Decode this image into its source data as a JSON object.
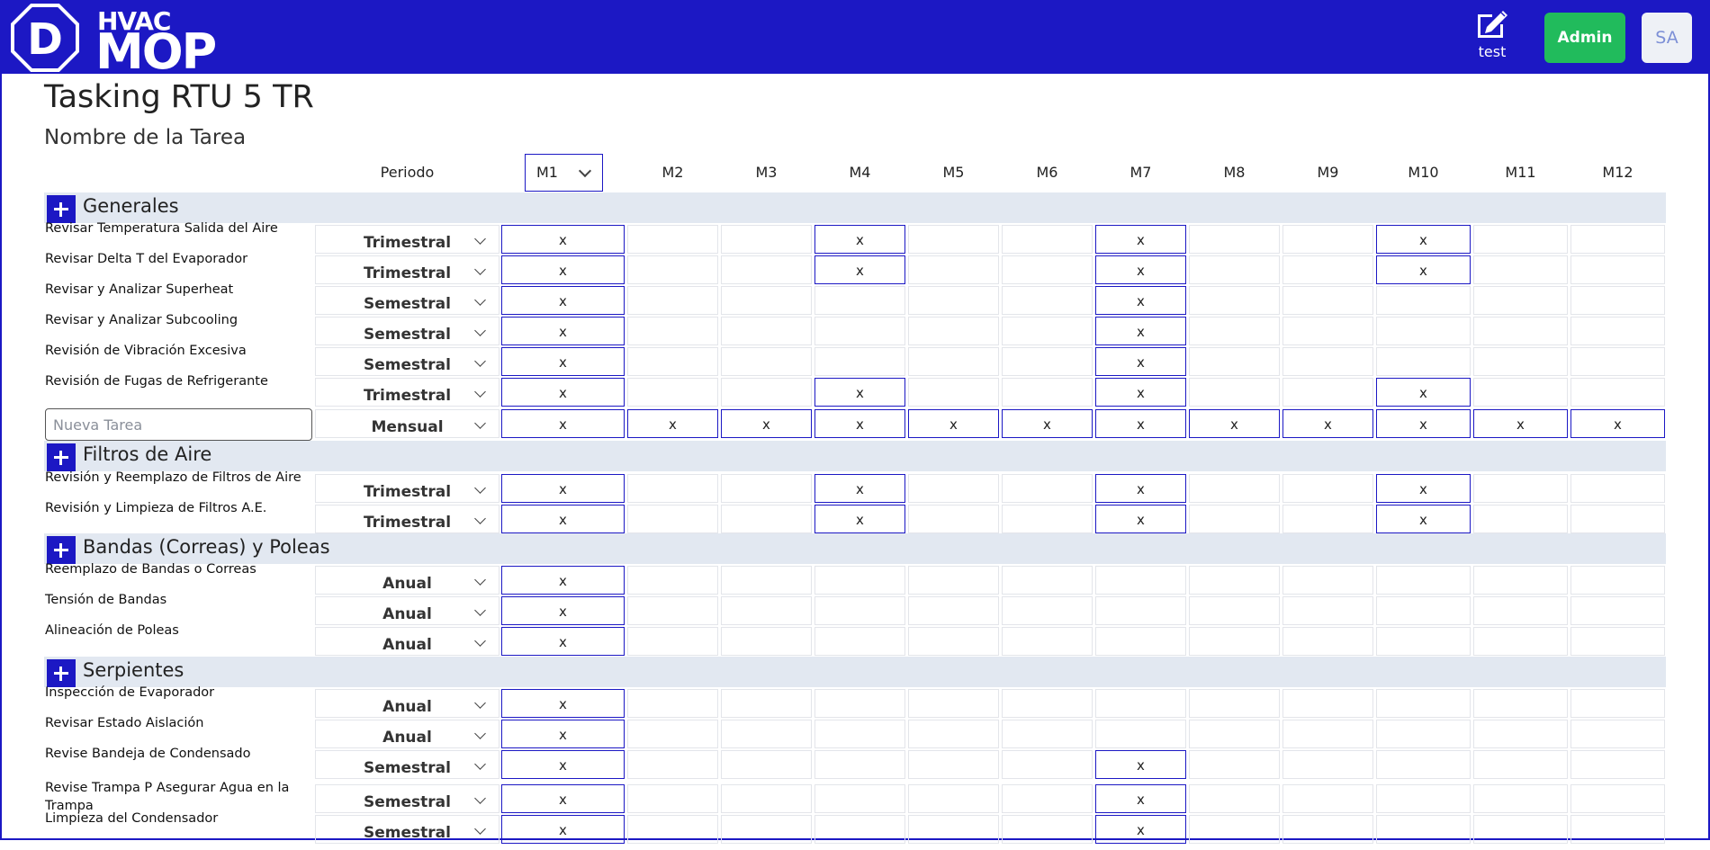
{
  "header": {
    "logo_hvac": "HVAC",
    "logo_mop": "MOP",
    "logo_mark": "D",
    "edit_label": "test",
    "admin_label": "Admin",
    "avatar_initials": "SA",
    "accent_color": "#1c18c4",
    "admin_color": "#21bb5c"
  },
  "page": {
    "title": "Tasking RTU 5 TR",
    "subtitle": "Nombre de la Tarea",
    "periodo_header": "Periodo",
    "selected_month": "M1",
    "month_headers": [
      "M2",
      "M3",
      "M4",
      "M5",
      "M6",
      "M7",
      "M8",
      "M9",
      "M10",
      "M11",
      "M12"
    ],
    "mark": "x",
    "new_task_placeholder": "Nueva Tarea"
  },
  "sections": [
    {
      "title": "Generales",
      "tasks": [
        {
          "name": "Revisar Temperatura Salida del Aire",
          "period": "Trimestral",
          "months": [
            1,
            4,
            7,
            10
          ]
        },
        {
          "name": "Revisar Delta T del Evaporador",
          "period": "Trimestral",
          "months": [
            1,
            4,
            7,
            10
          ]
        },
        {
          "name": "Revisar y Analizar Superheat",
          "period": "Semestral",
          "months": [
            1,
            7
          ]
        },
        {
          "name": "Revisar y Analizar Subcooling",
          "period": "Semestral",
          "months": [
            1,
            7
          ]
        },
        {
          "name": "Revisión de Vibración Excesiva",
          "period": "Semestral",
          "months": [
            1,
            7
          ]
        },
        {
          "name": "Revisión de Fugas de Refrigerante",
          "period": "Trimestral",
          "months": [
            1,
            4,
            7,
            10
          ]
        }
      ],
      "new_task": {
        "period": "Mensual",
        "months": [
          1,
          2,
          3,
          4,
          5,
          6,
          7,
          8,
          9,
          10,
          11,
          12
        ]
      }
    },
    {
      "title": "Filtros de Aire",
      "tasks": [
        {
          "name": "Revisión y Reemplazo de Filtros de Aire",
          "period": "Trimestral",
          "months": [
            1,
            4,
            7,
            10
          ]
        },
        {
          "name": "Revisión y Limpieza de Filtros A.E.",
          "period": "Trimestral",
          "months": [
            1,
            4,
            7,
            10
          ]
        }
      ]
    },
    {
      "title": "Bandas (Correas) y Poleas",
      "tasks": [
        {
          "name": "Reemplazo de Bandas o Correas",
          "period": "Anual",
          "months": [
            1
          ]
        },
        {
          "name": "Tensión de Bandas",
          "period": "Anual",
          "months": [
            1
          ]
        },
        {
          "name": "Alineación de Poleas",
          "period": "Anual",
          "months": [
            1
          ]
        }
      ]
    },
    {
      "title": "Serpientes",
      "tasks": [
        {
          "name": "Inspección de Evaporador",
          "period": "Anual",
          "months": [
            1
          ]
        },
        {
          "name": "Revisar Estado Aislación",
          "period": "Anual",
          "months": [
            1
          ]
        },
        {
          "name": "Revise Bandeja de Condensado",
          "period": "Semestral",
          "months": [
            1,
            7
          ]
        },
        {
          "name": "Revise Trampa P Asegurar Agua en la Trampa",
          "period": "Semestral",
          "months": [
            1,
            7
          ]
        },
        {
          "name": "Limpieza del Condensador",
          "period": "Semestral",
          "months": [
            1,
            7
          ]
        }
      ]
    }
  ]
}
